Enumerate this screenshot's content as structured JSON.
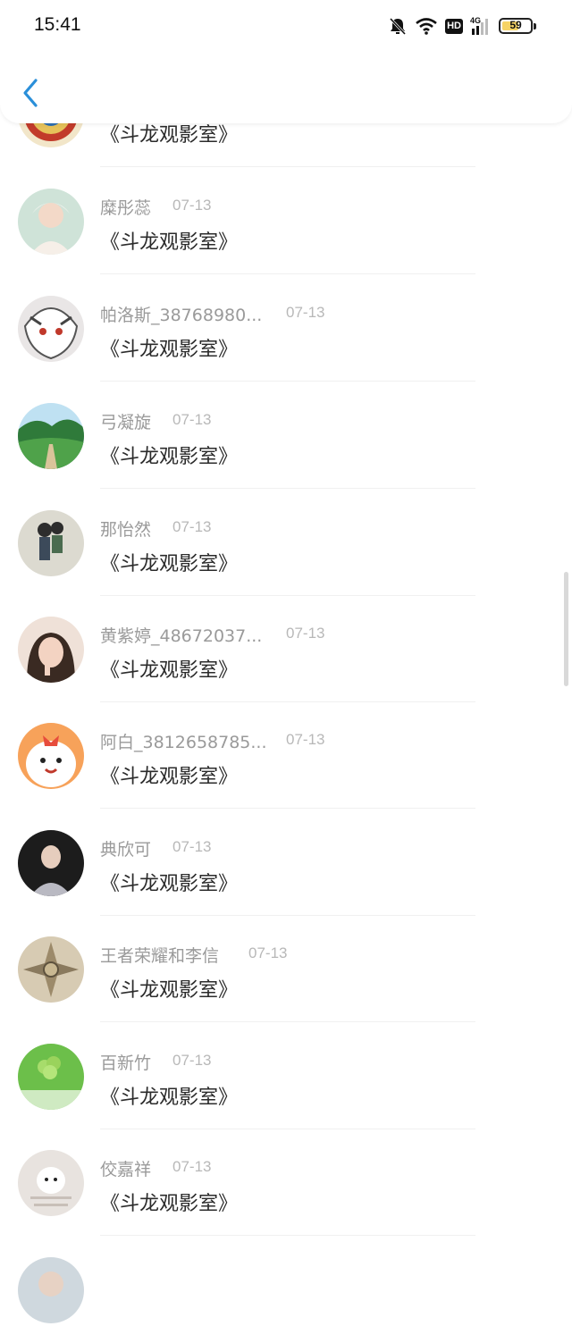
{
  "status_bar": {
    "time": "15:41",
    "hd": "HD",
    "network": "4G",
    "battery": "59",
    "battery_level": 0.59
  },
  "header": {
    "back_icon": "chevron-left-icon",
    "accent": "#2a8fd9"
  },
  "items": [
    {
      "name": "",
      "date": "",
      "message": "《斗龙观影室》"
    },
    {
      "name": "糜彤蕊",
      "date": "07-13",
      "message": "《斗龙观影室》"
    },
    {
      "name": "帕洛斯_38768980...",
      "date": "07-13",
      "message": "《斗龙观影室》"
    },
    {
      "name": "弓凝旋",
      "date": "07-13",
      "message": "《斗龙观影室》"
    },
    {
      "name": "那怡然",
      "date": "07-13",
      "message": "《斗龙观影室》"
    },
    {
      "name": "黄紫婷_48672037...",
      "date": "07-13",
      "message": "《斗龙观影室》"
    },
    {
      "name": "阿白_3812658785...",
      "date": "07-13",
      "message": "《斗龙观影室》"
    },
    {
      "name": "典欣可",
      "date": "07-13",
      "message": "《斗龙观影室》"
    },
    {
      "name": "王者荣耀和李信",
      "date": "07-13",
      "message": "《斗龙观影室》"
    },
    {
      "name": "百新竹",
      "date": "07-13",
      "message": "《斗龙观影室》"
    },
    {
      "name": "佼嘉祥",
      "date": "07-13",
      "message": "《斗龙观影室》"
    }
  ]
}
